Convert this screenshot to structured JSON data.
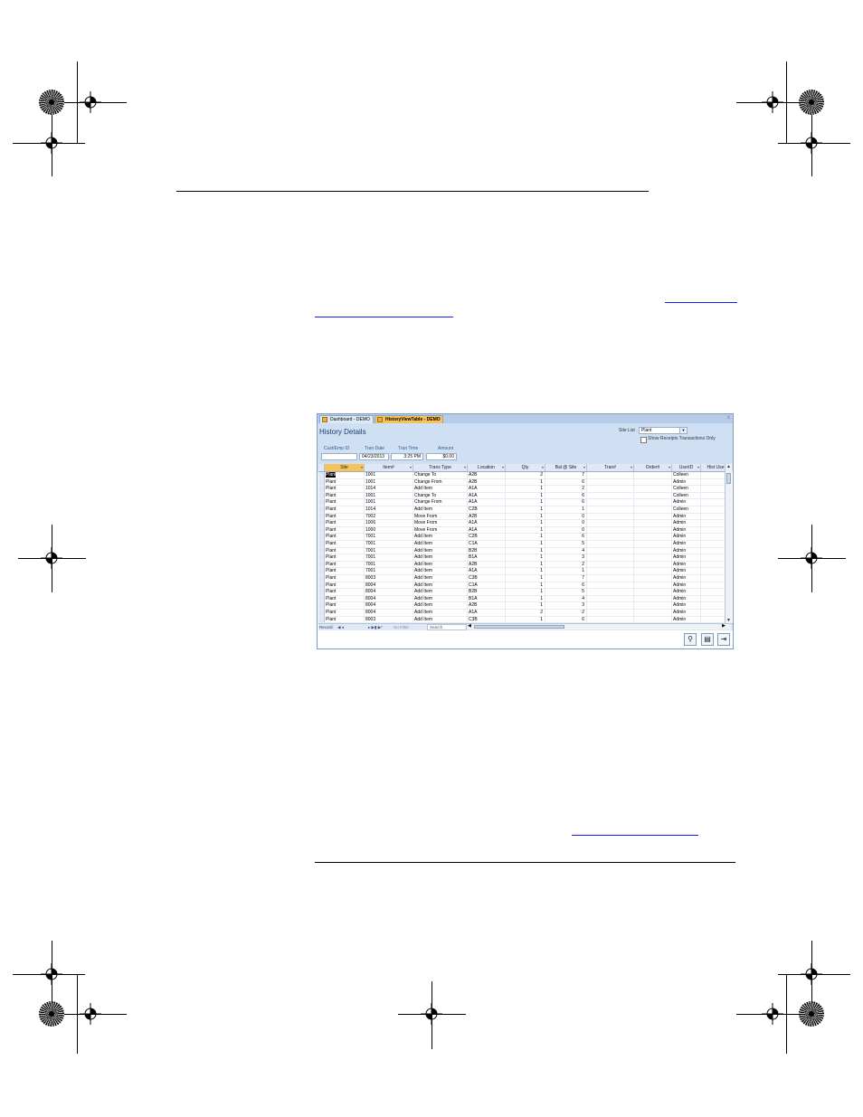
{
  "app": {
    "tabs": [
      {
        "label": "Dashboard - DEMO"
      },
      {
        "label": "HistoryViewTable - DEMO"
      }
    ],
    "close_glyph": "x",
    "title": "History Details",
    "fields": {
      "cust_emp_label": "Cust/Emp ID",
      "cust_emp_value": "",
      "tran_date_label": "Tran Date",
      "tran_date_value": "04/23/2013",
      "tran_time_label": "Tran Time",
      "tran_time_value": "3:25 PM",
      "amount_label": "Amount",
      "amount_value": "$0.00"
    },
    "site_list": {
      "label": "Site List",
      "value": "Plant",
      "checkbox_label": "Show Receipts Transactions Only"
    },
    "columns": [
      "Site",
      "Item#",
      "Trans Type",
      "Location",
      "Qty",
      "Bal @ Site",
      "Tran#",
      "Order#",
      "UserID",
      "Hist Use"
    ],
    "rows": [
      [
        "Plant",
        "1001",
        "Change To",
        "A2B",
        "2",
        "7",
        "",
        "",
        "Colleen",
        ""
      ],
      [
        "Plant",
        "1001",
        "Change From",
        "A2B",
        "1",
        "6",
        "",
        "",
        "Admin",
        ""
      ],
      [
        "Plant",
        "1014",
        "Add Item",
        "A1A",
        "1",
        "2",
        "",
        "",
        "Colleen",
        ""
      ],
      [
        "Plant",
        "1001",
        "Change To",
        "A1A",
        "1",
        "6",
        "",
        "",
        "Colleen",
        ""
      ],
      [
        "Plant",
        "1001",
        "Change From",
        "A1A",
        "1",
        "6",
        "",
        "",
        "Admin",
        ""
      ],
      [
        "Plant",
        "1014",
        "Add Item",
        "C2B",
        "1",
        "1",
        "",
        "",
        "Colleen",
        ""
      ],
      [
        "Plant",
        "7002",
        "Move From",
        "A2B",
        "1",
        "0",
        "",
        "",
        "Admin",
        ""
      ],
      [
        "Plant",
        "1006",
        "Move From",
        "A1A",
        "1",
        "0",
        "",
        "",
        "Admin",
        ""
      ],
      [
        "Plant",
        "1000",
        "Move From",
        "A1A",
        "1",
        "0",
        "",
        "",
        "Admin",
        ""
      ],
      [
        "Plant",
        "7001",
        "Add Item",
        "C2B",
        "1",
        "6",
        "",
        "",
        "Admin",
        ""
      ],
      [
        "Plant",
        "7001",
        "Add Item",
        "C1A",
        "1",
        "5",
        "",
        "",
        "Admin",
        ""
      ],
      [
        "Plant",
        "7001",
        "Add Item",
        "B2B",
        "1",
        "4",
        "",
        "",
        "Admin",
        ""
      ],
      [
        "Plant",
        "7001",
        "Add Item",
        "B1A",
        "1",
        "3",
        "",
        "",
        "Admin",
        ""
      ],
      [
        "Plant",
        "7001",
        "Add Item",
        "A2B",
        "1",
        "2",
        "",
        "",
        "Admin",
        ""
      ],
      [
        "Plant",
        "7001",
        "Add Item",
        "A1A",
        "1",
        "1",
        "",
        "",
        "Admin",
        ""
      ],
      [
        "Plant",
        "8003",
        "Add Item",
        "C3B",
        "1",
        "7",
        "",
        "",
        "Admin",
        ""
      ],
      [
        "Plant",
        "8004",
        "Add Item",
        "C1A",
        "1",
        "6",
        "",
        "",
        "Admin",
        ""
      ],
      [
        "Plant",
        "8004",
        "Add Item",
        "B2B",
        "1",
        "5",
        "",
        "",
        "Admin",
        ""
      ],
      [
        "Plant",
        "8004",
        "Add Item",
        "B1A",
        "1",
        "4",
        "",
        "",
        "Admin",
        ""
      ],
      [
        "Plant",
        "8004",
        "Add Item",
        "A2B",
        "1",
        "3",
        "",
        "",
        "Admin",
        ""
      ],
      [
        "Plant",
        "8004",
        "Add Item",
        "A1A",
        "2",
        "2",
        "",
        "",
        "Admin",
        ""
      ],
      [
        "Plant",
        "8003",
        "Add Item",
        "C3B",
        "1",
        "6",
        "",
        "",
        "Admin",
        ""
      ]
    ],
    "navbar": {
      "record_label": "Record:",
      "nav_arrows": "◀ ◂",
      "nav_next": "▸ ▶▮ ▶*",
      "filter_label": "No Filter",
      "search_label": "Search"
    },
    "buttons": [
      {
        "name": "binoculars-icon",
        "glyph": "⚲"
      },
      {
        "name": "print-icon",
        "glyph": "▤"
      },
      {
        "name": "exit-icon",
        "glyph": "⇥"
      }
    ]
  }
}
